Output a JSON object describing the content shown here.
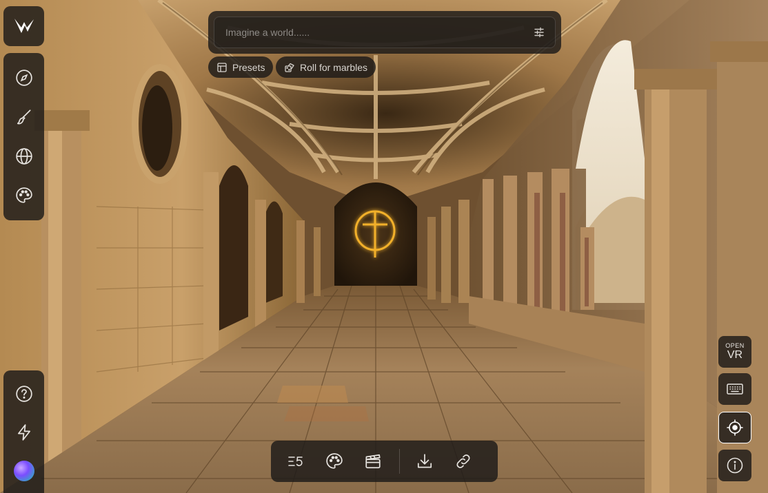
{
  "brand": {
    "logo_icon": "world-labs-logo-icon"
  },
  "sidebar": {
    "top_items": [
      {
        "name": "explore",
        "icon": "compass-icon"
      },
      {
        "name": "create",
        "icon": "brush-icon"
      },
      {
        "name": "worlds",
        "icon": "globe-icon"
      },
      {
        "name": "style",
        "icon": "palette-icon"
      }
    ],
    "bottom_items": [
      {
        "name": "help",
        "icon": "help-circle-icon"
      },
      {
        "name": "lightning",
        "icon": "lightning-icon"
      },
      {
        "name": "profile",
        "icon": "avatar"
      }
    ]
  },
  "prompt": {
    "placeholder": "Imagine a world......",
    "value": "",
    "settings_icon": "sliders-icon"
  },
  "chips": {
    "presets_label": "Presets",
    "roll_label": "Roll for marbles"
  },
  "toolbar": {
    "items": [
      {
        "name": "list-steps",
        "icon": "list-steps-icon"
      },
      {
        "name": "palette",
        "icon": "palette-icon"
      },
      {
        "name": "clapper",
        "icon": "clapperboard-icon"
      },
      {
        "name": "download",
        "icon": "download-icon"
      },
      {
        "name": "share-link",
        "icon": "link-icon"
      }
    ]
  },
  "right_controls": {
    "vr_small": "OPEN",
    "vr_big": "VR",
    "keyboard_icon": "keyboard-icon",
    "recenter_icon": "crosshair-icon",
    "info_icon": "info-icon"
  },
  "colors": {
    "panel_bg": "#1c1a18",
    "icon": "#e6e3df",
    "glow": "#f2b02a"
  }
}
